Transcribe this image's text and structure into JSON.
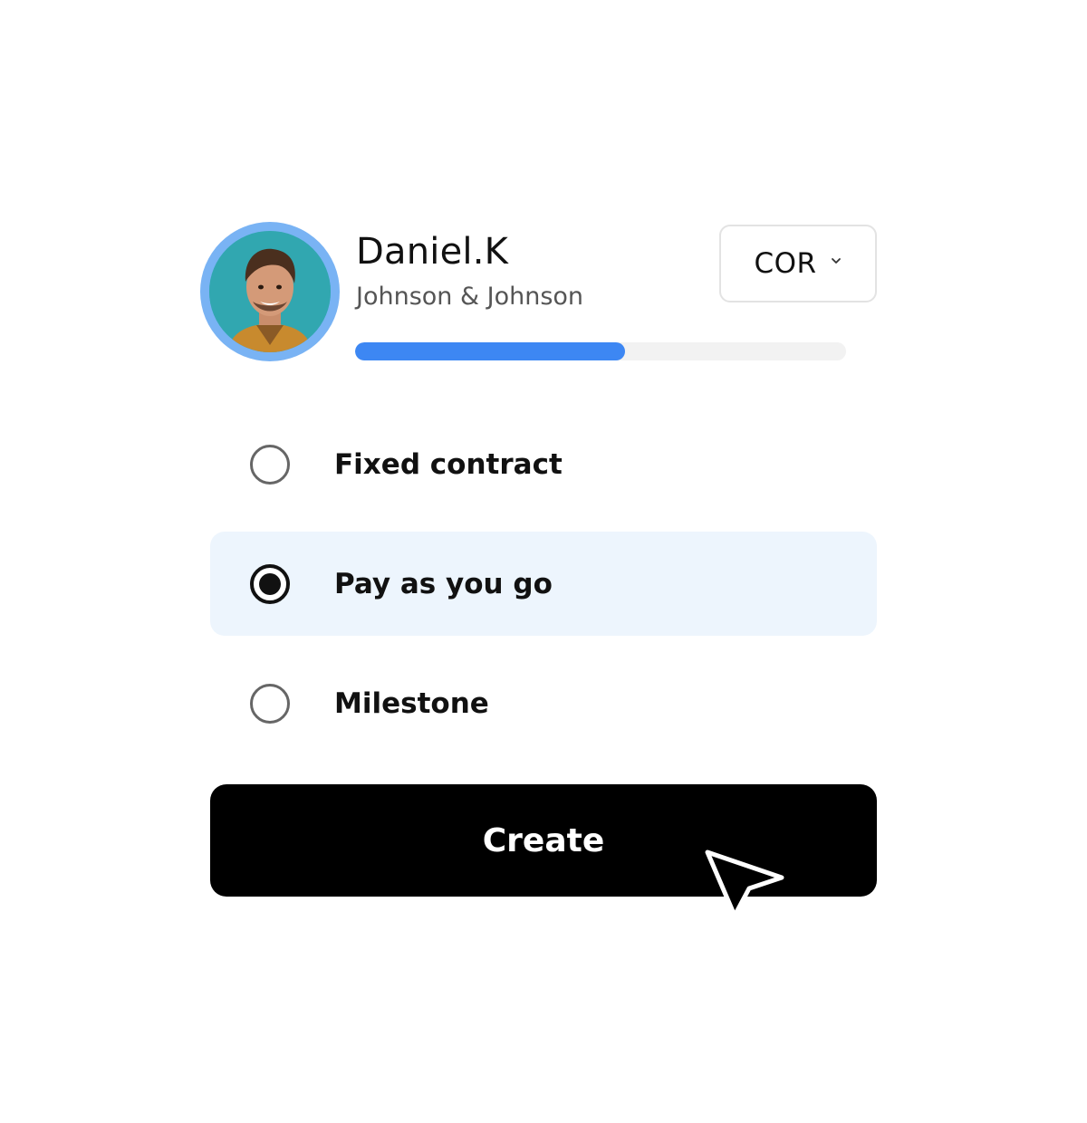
{
  "profile": {
    "name": "Daniel.K",
    "company": "Johnson & Johnson",
    "progress": 0.55
  },
  "currency": {
    "selected": "COR"
  },
  "contract_options": [
    {
      "label": "Fixed contract",
      "selected": false
    },
    {
      "label": "Pay as you go",
      "selected": true
    },
    {
      "label": "Milestone",
      "selected": false
    }
  ],
  "actions": {
    "create_label": "Create"
  },
  "colors": {
    "accent": "#3d87f3",
    "avatar_ring": "#79b3f4",
    "selected_bg": "#edf5fd",
    "button_bg": "#000000"
  }
}
